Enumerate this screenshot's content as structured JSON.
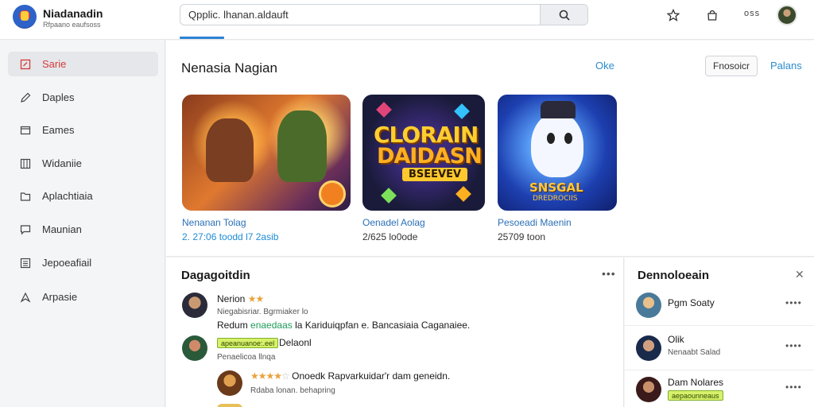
{
  "app": {
    "title": "Niadanadin",
    "subtitle": "Rfpaano eaufsoss"
  },
  "search": {
    "value": "Qpplic. lhanan.aldauft"
  },
  "toolbar": {
    "dots": "oss"
  },
  "sidebar": {
    "items": [
      {
        "label": "Sarie",
        "icon": "square-icon"
      },
      {
        "label": "Daples",
        "icon": "pencil-icon"
      },
      {
        "label": "Eames",
        "icon": "window-icon"
      },
      {
        "label": "Widaniie",
        "icon": "grid-icon"
      },
      {
        "label": "Aplachtiaia",
        "icon": "folder-icon"
      },
      {
        "label": "Maunian",
        "icon": "chat-icon"
      },
      {
        "label": "Jepoeafiail",
        "icon": "list-icon"
      },
      {
        "label": "Arpasie",
        "icon": "compass-icon"
      }
    ]
  },
  "featured": {
    "title": "Nenasia Nagian",
    "ok_label": "Oke",
    "button_label": "Fnosoicr",
    "link_label": "Palans",
    "games": [
      {
        "name": "Nenanan Tolag",
        "meta": "2. 27:06 toodd l7 2asib",
        "name_color": "#2a6fb6",
        "meta_color": "#1e8bd6"
      },
      {
        "name": "Oenadel Aolag",
        "meta": "2/625 lo0ode",
        "name_color": "#2a6fb6",
        "meta_color": "#333333",
        "art_lines": [
          "CLORAIN",
          "DAIDASN",
          "BSEEVEV"
        ]
      },
      {
        "name": "Pesoeadi Maenin",
        "meta": "25709 toon",
        "name_color": "#2a6fb6",
        "meta_color": "#333333",
        "art_lines": [
          "SNSGAL",
          "DREDROCIIS"
        ]
      }
    ]
  },
  "recent": {
    "title": "Dagagoitdin",
    "more": "•••",
    "reviews": [
      {
        "name": "Nerion",
        "stars": "★★",
        "sub": "Niegabisriar. Bgrmiaker lo",
        "body_prefix": "Redum",
        "body_highlight": "enaedaas",
        "body_rest": "la  Kariduiqpfan e. Bancasiaia Caganaiee."
      },
      {
        "badge": "apeanuanoe:.eel",
        "name": "Delaonl",
        "sub": "Penaelicoa llnqa"
      },
      {
        "stars": "★★★★",
        "star_tail": "☆",
        "body": "Onoedk  Rapvarkuidar'r dam geneidn.",
        "sub": "Rdaba lonan. behapring"
      }
    ]
  },
  "panel": {
    "title": "Dennoloeain",
    "close": "✕",
    "rows": [
      {
        "name": "Pgm Soaty",
        "sub": "",
        "dots": "••••"
      },
      {
        "name": "Olik",
        "sub": "Nenaabt Salad",
        "dots": "••••"
      },
      {
        "name": "Dam Nolares",
        "sub": "",
        "badge": "aepaounneaus",
        "dots": "••••"
      }
    ]
  },
  "colors": {
    "accent": "#2b83d6",
    "active": "#d23b3b",
    "star": "#e9a23b",
    "link": "#2b8ccd"
  }
}
